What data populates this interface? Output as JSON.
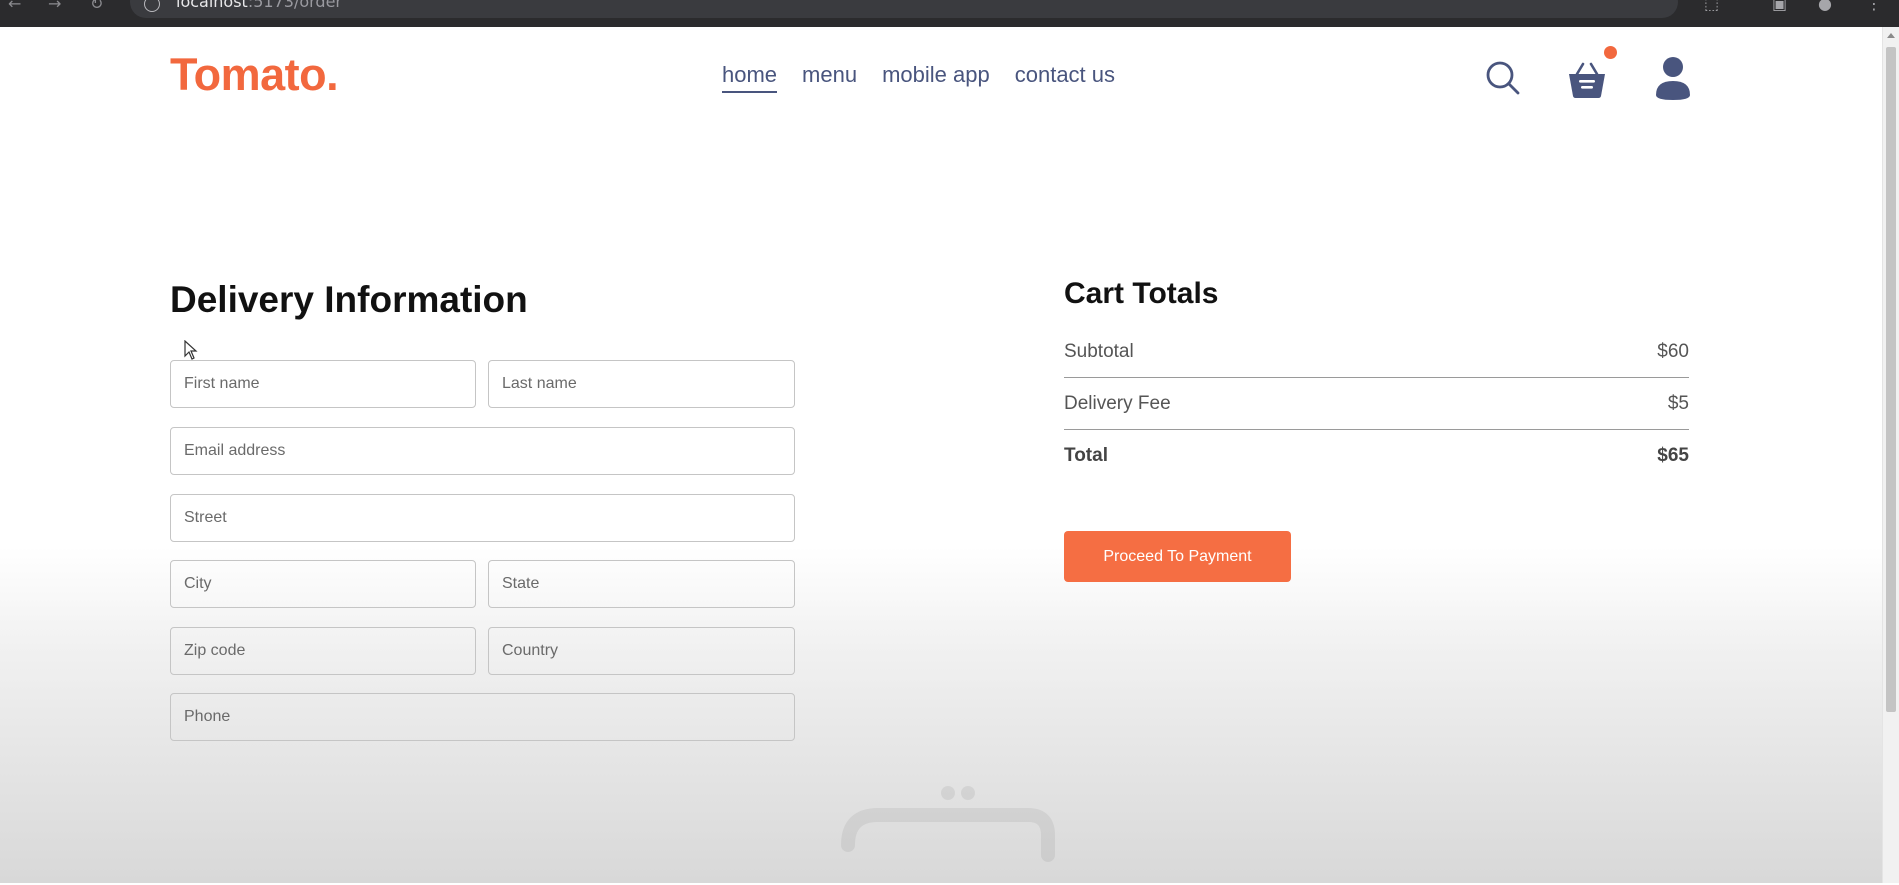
{
  "browser": {
    "url_host": "localhost",
    "url_path": ":5173/order"
  },
  "header": {
    "logo": "Tomato.",
    "nav": [
      {
        "label": "home",
        "active": true
      },
      {
        "label": "menu",
        "active": false
      },
      {
        "label": "mobile app",
        "active": false
      },
      {
        "label": "contact us",
        "active": false
      }
    ],
    "icons": [
      "search-icon",
      "basket-icon",
      "profile-icon"
    ],
    "cart_has_items": true
  },
  "delivery": {
    "title": "Delivery Information",
    "fields": {
      "first_name": "First name",
      "last_name": "Last name",
      "email": "Email address",
      "street": "Street",
      "city": "City",
      "state": "State",
      "zip": "Zip code",
      "country": "Country",
      "phone": "Phone"
    }
  },
  "cart": {
    "title": "Cart Totals",
    "rows": [
      {
        "label": "Subtotal",
        "value": "$60"
      },
      {
        "label": "Delivery Fee",
        "value": "$5"
      },
      {
        "label": "Total",
        "value": "$65"
      }
    ],
    "button": "Proceed To Payment"
  },
  "colors": {
    "brand": "#f2683e",
    "nav_text": "#49557e",
    "button": "#f56e43"
  }
}
